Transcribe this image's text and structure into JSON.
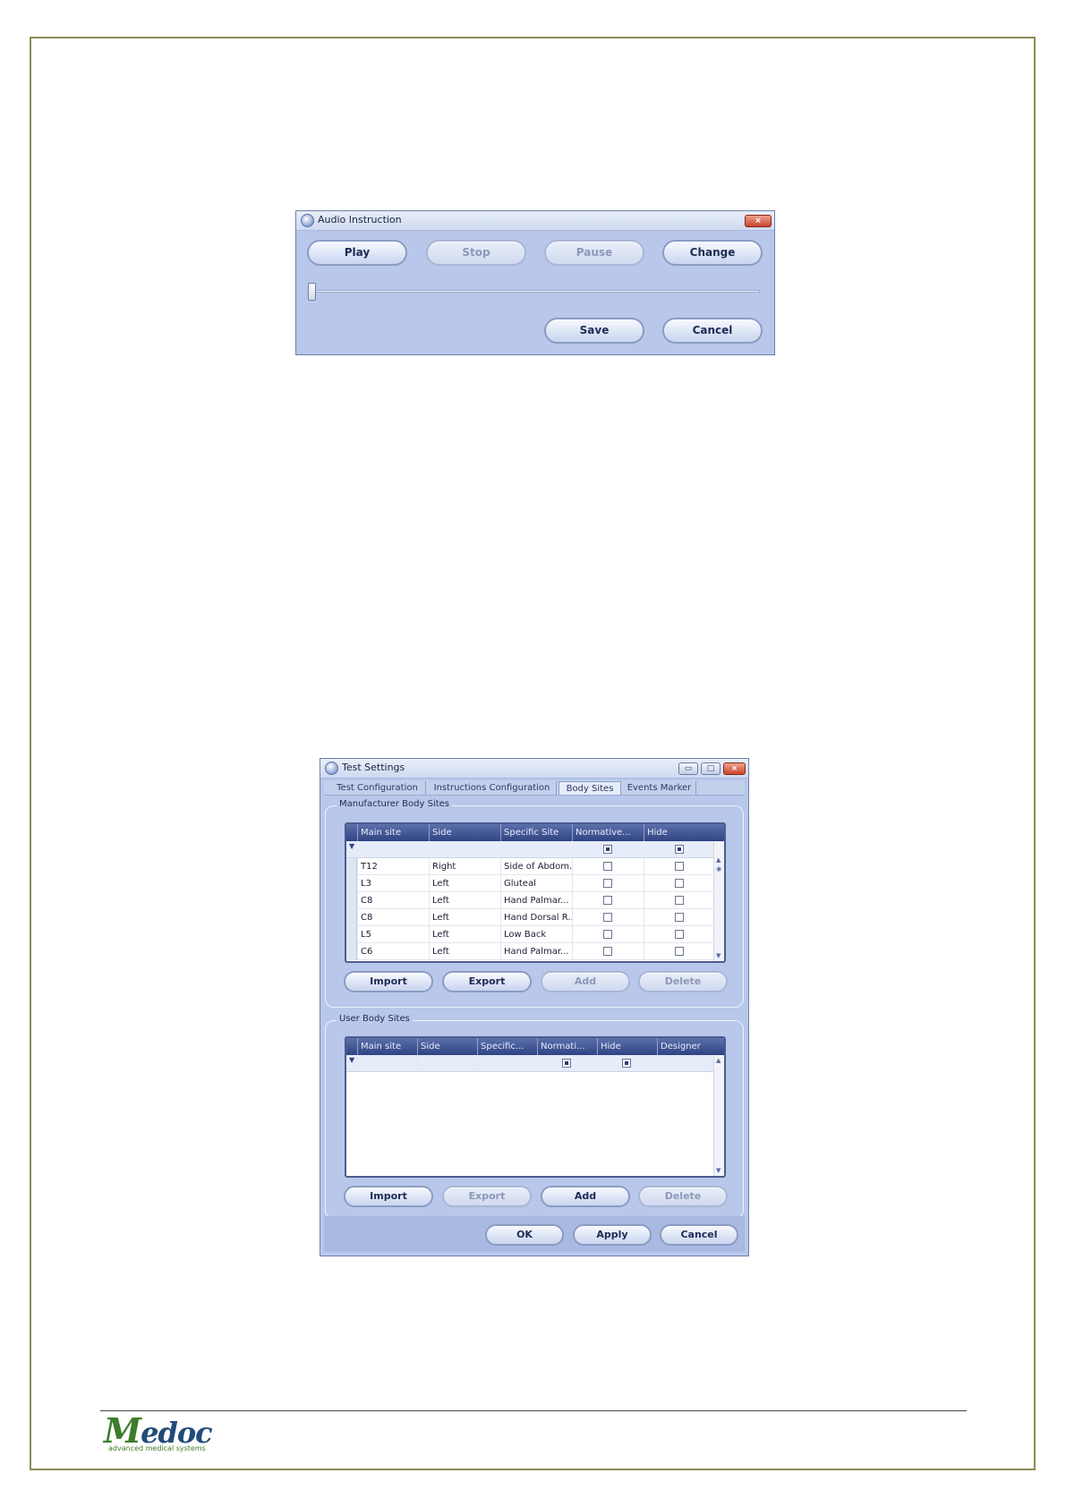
{
  "audio_window": {
    "title": "Audio Instruction",
    "close_glyph": "×",
    "buttons": {
      "play": "Play",
      "stop": "Stop",
      "pause": "Pause",
      "change": "Change",
      "save": "Save",
      "cancel": "Cancel"
    },
    "progress_fraction": 0.0
  },
  "settings_window": {
    "title": "Test Settings",
    "controls": {
      "minimize": "▭",
      "maximize": "□",
      "close": "×"
    },
    "tabs": [
      "Test Configuration",
      "Instructions Configuration",
      "Body Sites",
      "Events Marker"
    ],
    "active_tab": "Body Sites",
    "manufacturer": {
      "label": "Manufacturer Body Sites",
      "columns": [
        "Main site",
        "Side",
        "Specific Site",
        "Normative...",
        "Hide"
      ],
      "filter_normative": "indeterminate",
      "filter_hide": "indeterminate",
      "rows": [
        {
          "main": "T12",
          "side": "Right",
          "specific": "Side of Abdom...",
          "normative": false,
          "hide": false
        },
        {
          "main": "L3",
          "side": "Left",
          "specific": "Gluteal",
          "normative": false,
          "hide": false
        },
        {
          "main": "C8",
          "side": "Left",
          "specific": "Hand Palmar...",
          "normative": false,
          "hide": false
        },
        {
          "main": "C8",
          "side": "Left",
          "specific": "Hand Dorsal R...",
          "normative": false,
          "hide": false
        },
        {
          "main": "L5",
          "side": "Left",
          "specific": "Low Back",
          "normative": false,
          "hide": false
        },
        {
          "main": "C6",
          "side": "Left",
          "specific": "Hand Palmar...",
          "normative": false,
          "hide": false
        }
      ],
      "buttons": {
        "import": "Import",
        "export": "Export",
        "add": "Add",
        "delete": "Delete"
      }
    },
    "user": {
      "label": "User Body Sites",
      "columns": [
        "Main site",
        "Side",
        "Specific...",
        "Normati...",
        "Hide",
        "Designer"
      ],
      "rows": [],
      "buttons": {
        "import": "Import",
        "export": "Export",
        "add": "Add",
        "delete": "Delete"
      }
    },
    "footer_buttons": {
      "ok": "OK",
      "apply": "Apply",
      "cancel": "Cancel"
    }
  },
  "footer": {
    "logo_text": "Medoc",
    "logo_tagline": "advanced medical systems"
  },
  "colors": {
    "window_bg": "#b8c7ea",
    "grid_header": "#2f4383",
    "logo_green": "#3c7d2a",
    "logo_blue": "#214b7a",
    "page_border": "#8c8a55"
  }
}
